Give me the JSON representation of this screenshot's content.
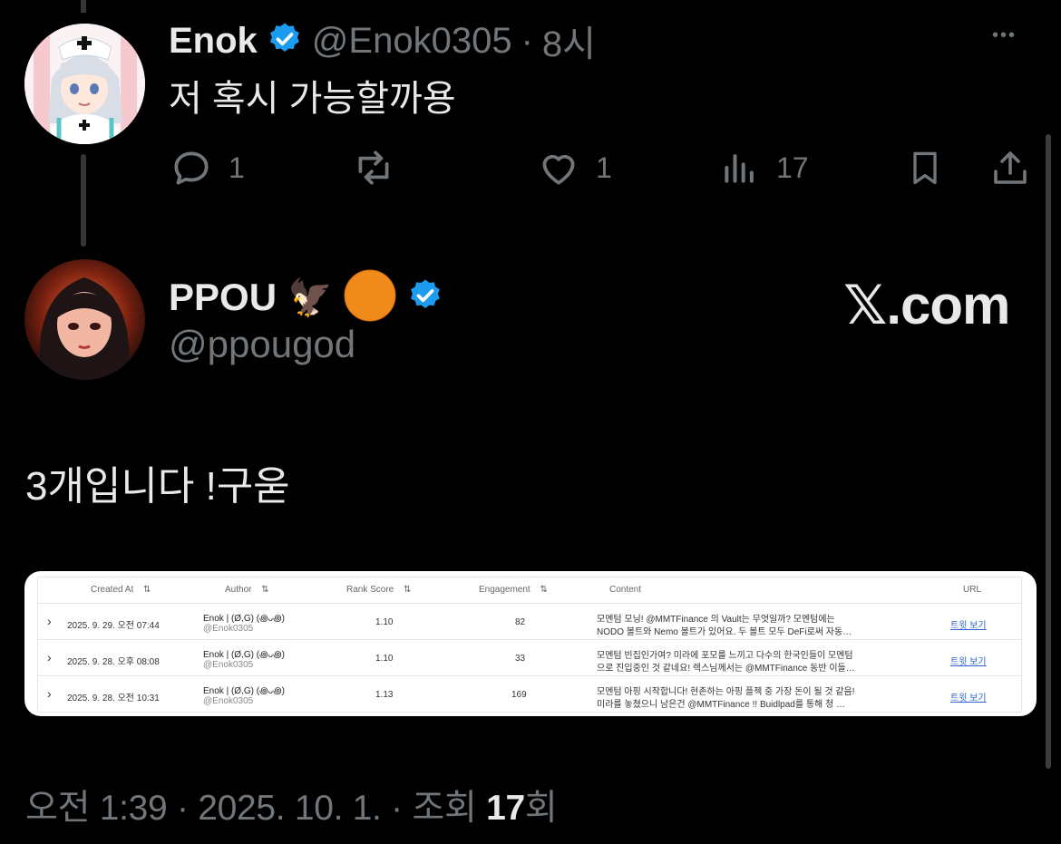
{
  "reply": {
    "name": "Enok",
    "handle": "@Enok0305",
    "separator": "·",
    "time": "8시",
    "text": "저 혹시 가능할까용",
    "more": "•••",
    "stats": {
      "replies": "1",
      "likes": "1",
      "views": "17"
    }
  },
  "main": {
    "name": "PPOU",
    "emoji_eagle": "🦅",
    "handle": "@ppougod",
    "brand": "𝕏.com",
    "text": "3개입니다 !구욷"
  },
  "table": {
    "headers": [
      "Created At",
      "Author",
      "Rank Score",
      "Engagement",
      "Content",
      "URL"
    ],
    "sort_glyph": "⇅",
    "rows": [
      {
        "expander": "›",
        "created": "2025. 9. 29. 오전 07:44",
        "author": "Enok | (Ø,G) (꩜ᴗ꩜)",
        "author_handle": "@Enok0305",
        "rank": "1.10",
        "engagement": "82",
        "content1": "모멘텀 모닝! @MMTFinance 의 Vault는 무엇일까? 모멘텀에는",
        "content2": "NODO 볼트와 Nemo 볼트가 있어요. 두 볼트 모두 DeFi로써 자동…",
        "url": "트윗 보기"
      },
      {
        "expander": "›",
        "created": "2025. 9. 28. 오후 08:08",
        "author": "Enok | (Ø,G) (꩜ᴗ꩜)",
        "author_handle": "@Enok0305",
        "rank": "1.10",
        "engagement": "33",
        "content1": "모멘텀 빈집인가여? 미라에 포모를 느끼고 다수의 한국인들이 모멘텀",
        "content2": "으로 진입중인 것 같네요! 렉스님께서는 @MMTFinance 동반 이들…",
        "url": "트윗 보기"
      },
      {
        "expander": "›",
        "created": "2025. 9. 28. 오전 10:31",
        "author": "Enok | (Ø,G) (꩜ᴗ꩜)",
        "author_handle": "@Enok0305",
        "rank": "1.13",
        "engagement": "169",
        "content1": "모멘텀 아핑 시작합니다! 현존하는 아핑 플젝 중 가장 돈이 될 것 같음!",
        "content2": "미라를 놓쳤으니 남은건 @MMTFinance !! Buidlpad를 통해 청 …",
        "url": "트윗 보기"
      }
    ]
  },
  "footer": {
    "time": "오전 1:39",
    "sep": "·",
    "date": "2025. 10. 1.",
    "views_label": "조회",
    "views_count": "17",
    "views_suffix": "회"
  },
  "colors": {
    "bg": "#000000",
    "text": "#e7e9ea",
    "muted": "#71767b",
    "verified": "#1d9bf0",
    "link": "#2a67c9"
  }
}
